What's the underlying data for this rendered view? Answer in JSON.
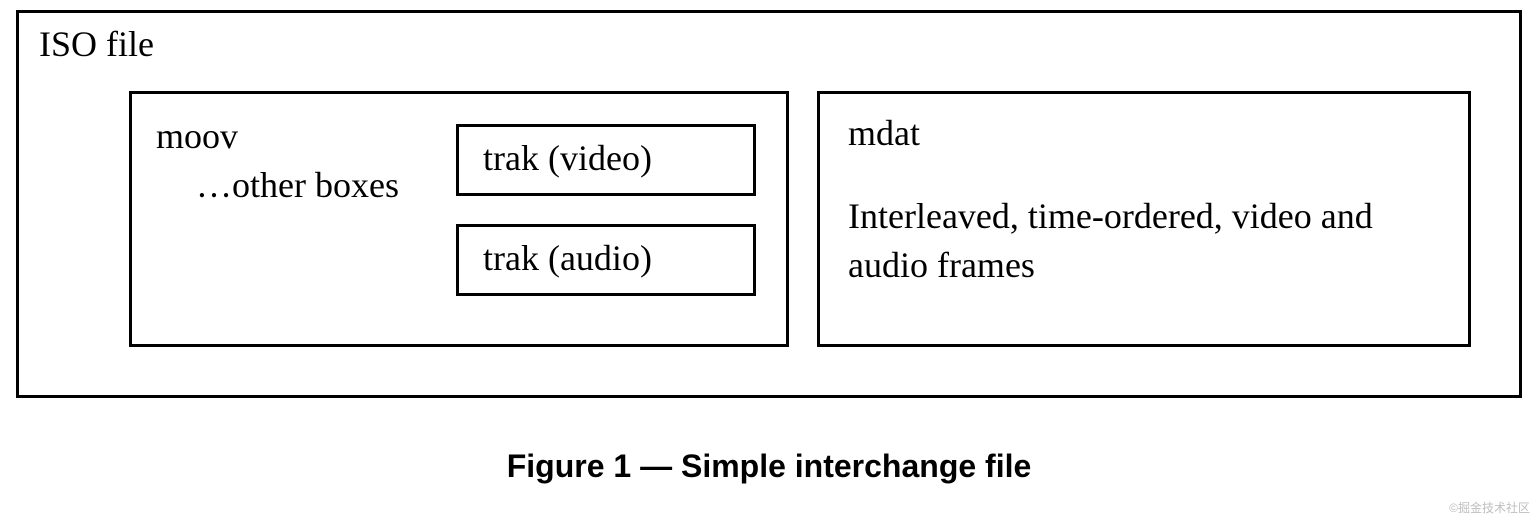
{
  "iso": {
    "title": "ISO file",
    "moov": {
      "title": "moov",
      "subtitle": "…other boxes",
      "traks": {
        "video": "trak (video)",
        "audio": "trak (audio)"
      }
    },
    "mdat": {
      "title": "mdat",
      "description": "Interleaved, time-ordered, video and audio frames"
    }
  },
  "caption": "Figure 1 — Simple interchange file",
  "watermark": "©掘金技术社区"
}
